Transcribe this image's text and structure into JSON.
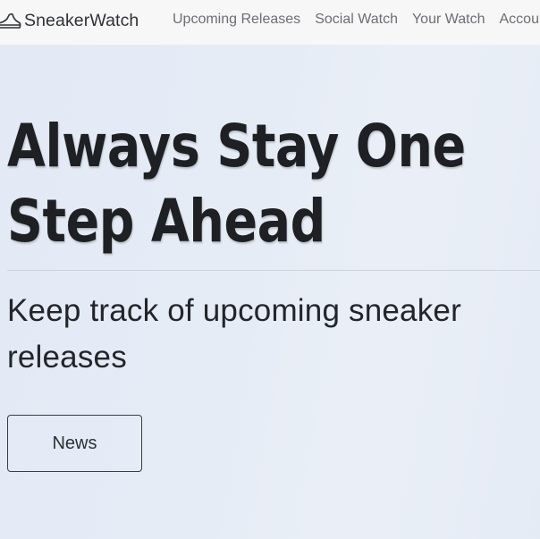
{
  "navbar": {
    "brand": "SneakerWatch",
    "brand_icon": "sneaker-icon",
    "links": [
      "Upcoming Releases",
      "Social Watch",
      "Your Watch",
      "Account"
    ]
  },
  "hero": {
    "title": "Always Stay One Step Ahead",
    "subtitle": "Keep track of upcoming sneaker releases",
    "button_label": "News"
  },
  "colors": {
    "navbar_bg": "#f7f7f8",
    "hero_bg": "#e5ebf5",
    "title_text": "#1e2024",
    "nav_link_text": "#6c6e72"
  }
}
